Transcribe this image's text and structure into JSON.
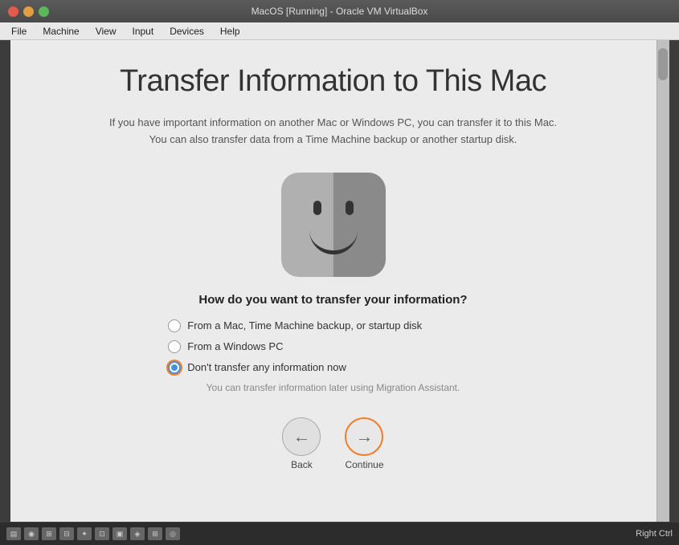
{
  "titleBar": {
    "title": "MacOS [Running] - Oracle VM VirtualBox",
    "closeBtn": "×",
    "minimizeBtn": "−",
    "maximizeBtn": "+"
  },
  "menuBar": {
    "items": [
      {
        "label": "File",
        "name": "menu-file"
      },
      {
        "label": "Machine",
        "name": "menu-machine"
      },
      {
        "label": "View",
        "name": "menu-view"
      },
      {
        "label": "Input",
        "name": "menu-input"
      },
      {
        "label": "Devices",
        "name": "menu-devices"
      },
      {
        "label": "Help",
        "name": "menu-help"
      }
    ]
  },
  "setupAssistant": {
    "mainTitle": "Transfer Information to This Mac",
    "subtitle1": "If you have important information on another Mac or Windows PC, you can transfer it to this Mac.",
    "subtitle2": "You can also transfer data from a Time Machine backup or another startup disk.",
    "question": "How do you want to transfer your information?",
    "options": [
      {
        "id": "option-mac",
        "label": "From a Mac, Time Machine backup, or startup disk",
        "selected": false
      },
      {
        "id": "option-windows",
        "label": "From a Windows PC",
        "selected": false
      },
      {
        "id": "option-none",
        "label": "Don't transfer any information now",
        "selected": true
      }
    ],
    "hintText": "You can transfer information later using Migration Assistant.",
    "backButton": "Back",
    "continueButton": "Continue",
    "backArrow": "←",
    "continueArrow": "→"
  },
  "statusBar": {
    "rightCtrlLabel": "Right Ctrl"
  }
}
